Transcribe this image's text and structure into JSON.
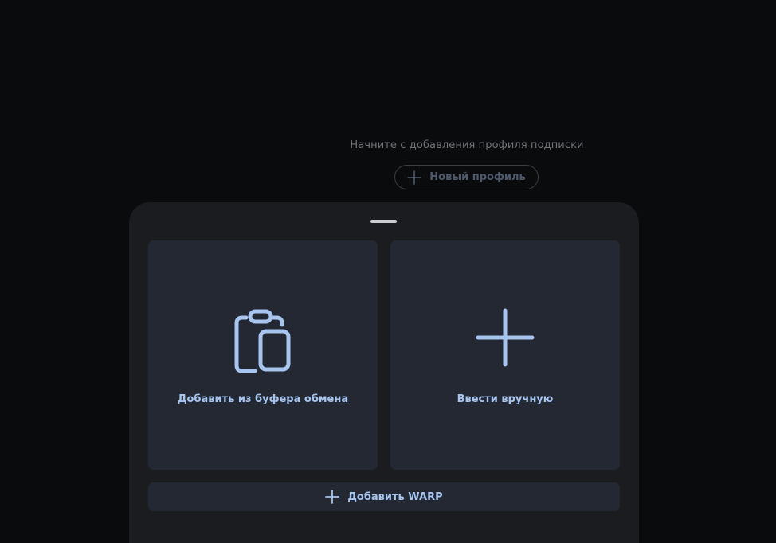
{
  "empty_state": {
    "hint": "Начните с добавления профиля подписки",
    "new_profile_label": "Новый профиль"
  },
  "sheet": {
    "clipboard_label": "Добавить из буфера обмена",
    "manual_label": "Ввести вручную",
    "warp_label": "Добавить WARP"
  },
  "colors": {
    "background": "#0a0b0d",
    "sheet": "#1b1c20",
    "card": "#232833",
    "accent": "#a8c5f0",
    "muted_text": "#6f7378",
    "disabled_button_text": "#4e5a6b"
  },
  "icons": {
    "new_profile": "plus-icon",
    "clipboard": "clipboard-icon",
    "manual": "plus-icon",
    "warp": "plus-icon"
  }
}
